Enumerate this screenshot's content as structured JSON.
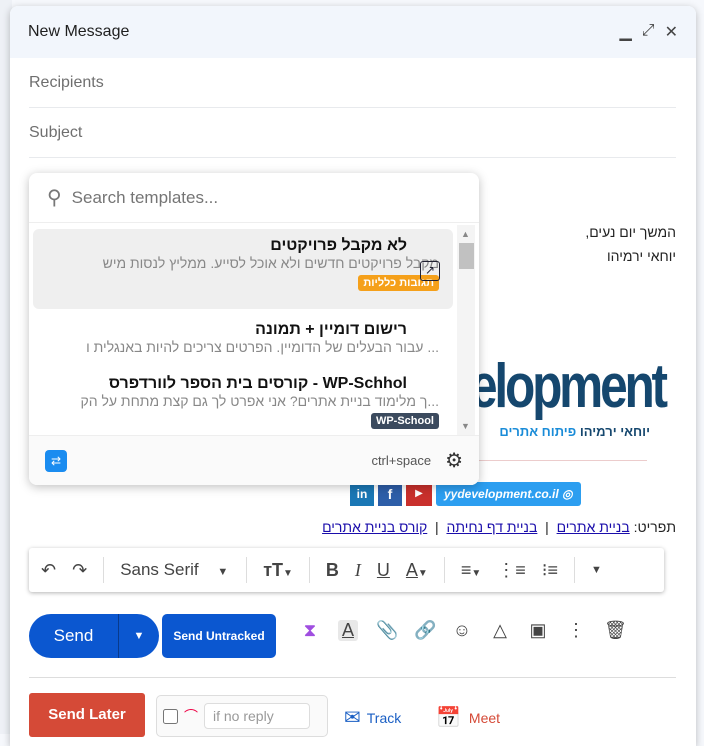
{
  "window": {
    "title": "New Message"
  },
  "fields": {
    "recipients": "Recipients",
    "subject": "Subject"
  },
  "body": {
    "line1": "המשך יום נעים,",
    "line2": "יוחאי ירמיהו",
    "logo_text": "elopment",
    "logo_sub_name": "יוחאי ירמיהו",
    "logo_sub_tag": "פיתוח אתרים",
    "website": "yydevelopment.co.il",
    "menu_label": "תפריט:",
    "links": [
      "בניית אתרים",
      "בניית דף נחיתה",
      "קורס בניית אתרים"
    ]
  },
  "templates": {
    "placeholder": "Search templates...",
    "shortcut": "ctrl+space",
    "items": [
      {
        "title": "לא מקבל פרויקטים",
        "snippet": "מקבל פרויקטים חדשים ולא אוכל לסייע. ממליץ לנסות מיש",
        "tag": "תגובות כלליות",
        "tag_color": "#f5a01a"
      },
      {
        "title": "רישום דומיין + תמונה",
        "snippet": "... עבור הבעלים של הדומיין. הפרטים צריכים להיות באנגלית ו"
      },
      {
        "title": "WP-Schhol - קורסים בית הספר לוורדפרס",
        "snippet": "...ך מלימוד בניית אתרים? אני אפרט לך גם קצת מתחת על הק",
        "tag": "WP-School",
        "tag_color": "#3b4a5e"
      }
    ]
  },
  "format": {
    "font": "Sans Serif"
  },
  "actions": {
    "send": "Send",
    "send_untracked": "Send Untracked",
    "send_later": "Send Later",
    "no_reply_placeholder": "if no reply",
    "track": "Track",
    "meet": "Meet"
  },
  "colors": {
    "send": "#0b57d0",
    "send_later": "#d54a37"
  }
}
